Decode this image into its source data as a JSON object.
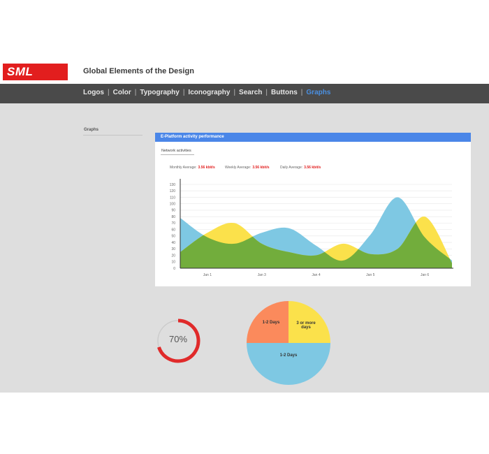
{
  "app": {
    "logo_text": "SML",
    "title": "Global Elements of the Design"
  },
  "nav": {
    "items": [
      {
        "label": "Logos",
        "active": false
      },
      {
        "label": "Color",
        "active": false
      },
      {
        "label": "Typography",
        "active": false
      },
      {
        "label": "Iconography",
        "active": false
      },
      {
        "label": "Search",
        "active": false
      },
      {
        "label": "Buttons",
        "active": false
      },
      {
        "label": "Graphs",
        "active": true
      }
    ],
    "separator": "|"
  },
  "sidebar": {
    "section_label": "Graphs"
  },
  "colors": {
    "brand_red": "#e21e1e",
    "nav_bg": "#4a4a4a",
    "nav_active": "#4a90e2",
    "card_header": "#4a86e8",
    "series_blue": "#7ec8e3",
    "series_yellow": "#fbe14b",
    "series_overlap": "#72ad3c",
    "pie_orange": "#fb8a5c",
    "pie_yellow": "#fbe14b",
    "pie_blue": "#7ec8e3",
    "donut_red": "#e02a2a",
    "donut_track": "#cccccc"
  },
  "card": {
    "title": "E-Platform activity performance",
    "subtitle": "Network activities",
    "stats": [
      {
        "label": "Monthly Average:",
        "value": "3.56 kbit/s"
      },
      {
        "label": "Weekly Average:",
        "value": "3.56 kbit/s"
      },
      {
        "label": "Daily Average:",
        "value": "3.56 kbit/s"
      }
    ]
  },
  "chart_data": [
    {
      "type": "area",
      "title": "",
      "xlabel": "",
      "ylabel": "",
      "ylim": [
        0,
        130
      ],
      "yticks": [
        0,
        10,
        20,
        30,
        40,
        50,
        60,
        70,
        80,
        90,
        100,
        110,
        120,
        130
      ],
      "x_tick_labels": [
        "Jan 1",
        "Jan 3",
        "Jan 4",
        "Jan 5",
        "Jan 6"
      ],
      "grid": true,
      "series": [
        {
          "color_key": "series_blue",
          "x": [
            0,
            1,
            2,
            3,
            4,
            5,
            6,
            7,
            8,
            9,
            10
          ],
          "values": [
            78,
            48,
            38,
            55,
            62,
            35,
            12,
            52,
            110,
            48,
            12
          ]
        },
        {
          "color_key": "series_yellow",
          "x": [
            0,
            1,
            2,
            3,
            4,
            5,
            6,
            7,
            8,
            9,
            10
          ],
          "values": [
            25,
            55,
            70,
            38,
            25,
            20,
            38,
            22,
            30,
            80,
            8
          ]
        }
      ]
    },
    {
      "type": "pie",
      "title": "",
      "categories": [
        "1-2 Days",
        "3 or more days",
        "1-2 Days"
      ],
      "values": [
        25,
        25,
        50
      ],
      "color_keys": [
        "pie_orange",
        "pie_yellow",
        "pie_blue"
      ]
    },
    {
      "type": "donut",
      "title": "",
      "value": 70,
      "label": "70%"
    }
  ]
}
